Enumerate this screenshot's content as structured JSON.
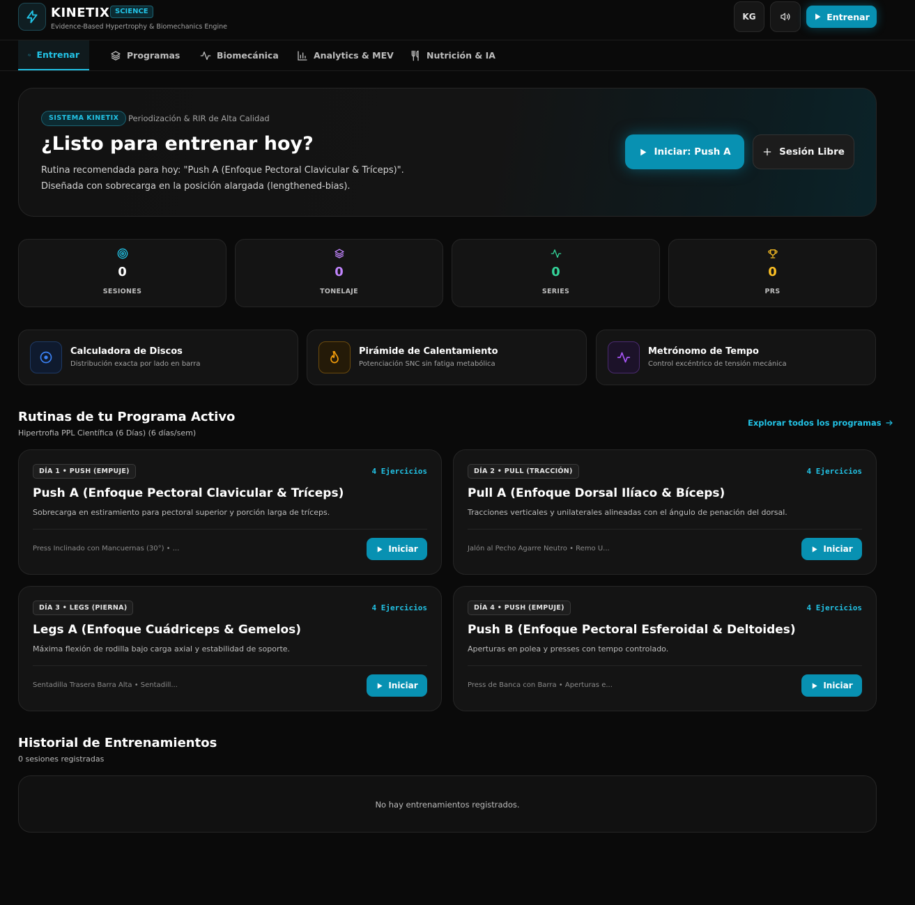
{
  "header": {
    "brand": "KINETIX",
    "badge": "SCIENCE",
    "subtitle": "Evidence-Based Hypertrophy & Biomechanics Engine",
    "unit_toggle": "KG",
    "primary_action": "Entrenar",
    "icons": {
      "logo": "lightning-icon",
      "sound": "speaker-icon",
      "play": "play-icon"
    }
  },
  "tabs": [
    {
      "label": "Entrenar",
      "icon": "dumbbell-icon",
      "active": true
    },
    {
      "label": "Programas",
      "icon": "layers-icon",
      "active": false
    },
    {
      "label": "Biomecánica",
      "icon": "activity-icon",
      "active": false
    },
    {
      "label": "Analytics & MEV",
      "icon": "bar-chart-icon",
      "active": false
    },
    {
      "label": "Nutrición & IA",
      "icon": "utensils-icon",
      "active": false
    }
  ],
  "hero": {
    "badge": "SISTEMA KINETIX",
    "badge_text": "Periodización & RIR de Alta Calidad",
    "title": "¿Listo para entrenar hoy?",
    "description": "Rutina recomendada para hoy: \"Push A (Enfoque Pectoral Clavicular & Tríceps)\". Diseñada con sobrecarga en la posición alargada (lengthened-bias).",
    "primary_button": "Iniciar: Push A",
    "secondary_button": "Sesión Libre"
  },
  "stats": [
    {
      "value": "0",
      "label": "SESIONES",
      "icon": "target-icon",
      "color": "#22c3e6"
    },
    {
      "value": "0",
      "label": "TONELAJE",
      "icon": "layers-icon",
      "color": "#c084fc"
    },
    {
      "value": "0",
      "label": "SERIES",
      "icon": "activity-icon",
      "color": "#34d399"
    },
    {
      "value": "0",
      "label": "PRS",
      "icon": "trophy-icon",
      "color": "#fbbf24"
    }
  ],
  "tools": [
    {
      "title": "Calculadora de Discos",
      "subtitle": "Distribución exacta por lado en barra",
      "icon": "disc-icon",
      "color": "#3b82f6"
    },
    {
      "title": "Pirámide de Calentamiento",
      "subtitle": "Potenciación SNC sin fatiga metabólica",
      "icon": "flame-icon",
      "color": "#f59e0b"
    },
    {
      "title": "Metrónomo de Tempo",
      "subtitle": "Control excéntrico de tensión mecánica",
      "icon": "pulse-icon",
      "color": "#a855f7"
    }
  ],
  "routines": {
    "title": "Rutinas de tu Programa Activo",
    "subtitle": "Hipertrofia PPL Científica (6 Días) (6 días/sem)",
    "explore_link": "Explorar todos los programas",
    "cards": [
      {
        "day": "DÍA 1 • PUSH (EMPUJE)",
        "count": "4 Ejercicios",
        "title": "Push A (Enfoque Pectoral Clavicular & Tríceps)",
        "description": "Sobrecarga en estiramiento para pectoral superior y porción larga de tríceps.",
        "exercises": "Press Inclinado con Mancuernas (30°) • ...",
        "button": "Iniciar"
      },
      {
        "day": "DÍA 2 • PULL (TRACCIÓN)",
        "count": "4 Ejercicios",
        "title": "Pull A (Enfoque Dorsal Ilíaco & Bíceps)",
        "description": "Tracciones verticales y unilaterales alineadas con el ángulo de penación del dorsal.",
        "exercises": "Jalón al Pecho Agarre Neutro • Remo U...",
        "button": "Iniciar"
      },
      {
        "day": "DÍA 3 • LEGS (PIERNA)",
        "count": "4 Ejercicios",
        "title": "Legs A (Enfoque Cuádriceps & Gemelos)",
        "description": "Máxima flexión de rodilla bajo carga axial y estabilidad de soporte.",
        "exercises": "Sentadilla Trasera Barra Alta • Sentadill...",
        "button": "Iniciar"
      },
      {
        "day": "DÍA 4 • PUSH (EMPUJE)",
        "count": "4 Ejercicios",
        "title": "Push B (Enfoque Pectoral Esferoidal & Deltoides)",
        "description": "Aperturas en polea y presses con tempo controlado.",
        "exercises": "Press de Banca con Barra • Aperturas e...",
        "button": "Iniciar"
      }
    ]
  },
  "history": {
    "title": "Historial de Entrenamientos",
    "subtitle": "0 sesiones registradas",
    "empty": "No hay entrenamientos registrados."
  }
}
